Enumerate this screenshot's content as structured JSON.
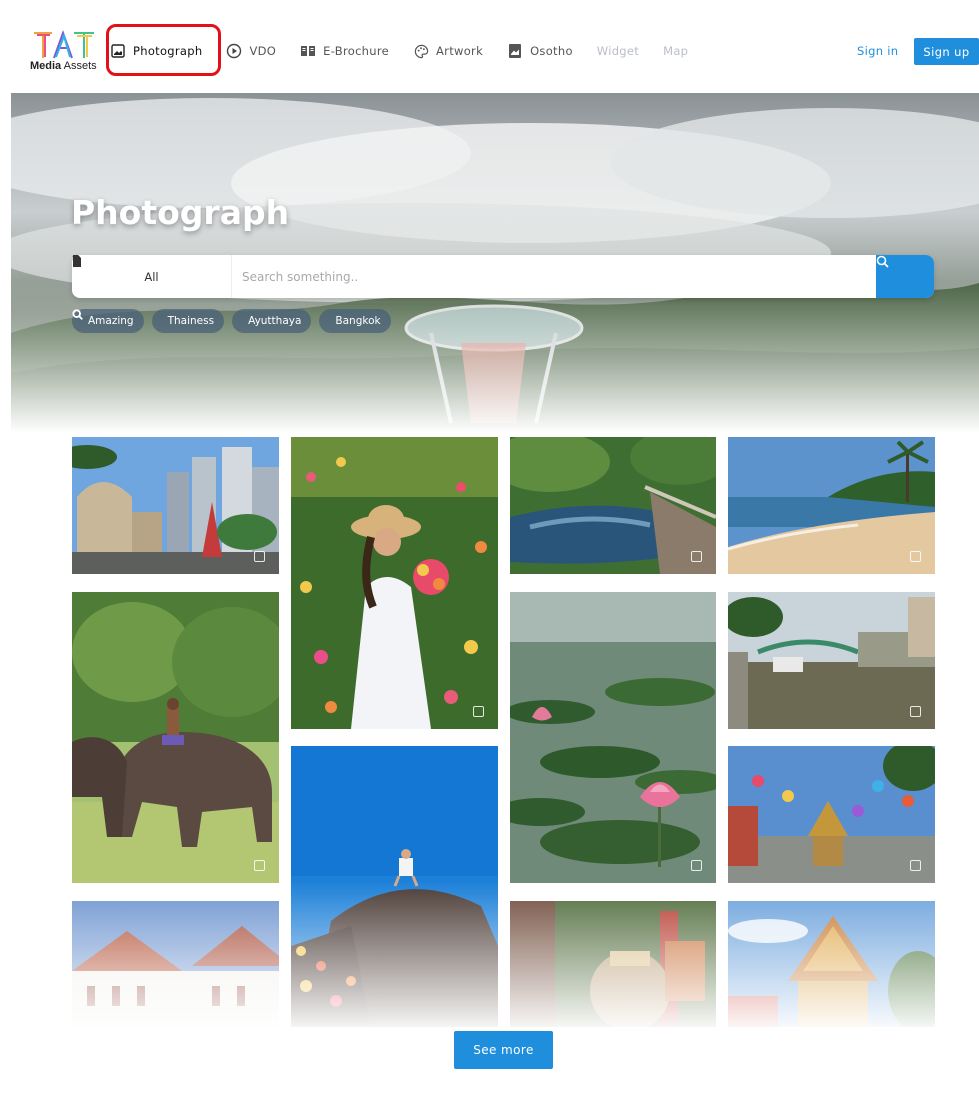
{
  "brand": {
    "logo_mark": "TAT",
    "logo_bold": "Media",
    "logo_rest": " Assets"
  },
  "nav": [
    {
      "label": "Photograph",
      "icon": "image-icon",
      "state": "active"
    },
    {
      "label": "VDO",
      "icon": "play-circle-icon",
      "state": "normal"
    },
    {
      "label": "E-Brochure",
      "icon": "book-open-icon",
      "state": "normal"
    },
    {
      "label": "Artwork",
      "icon": "palette-icon",
      "state": "normal"
    },
    {
      "label": "Osotho",
      "icon": "bookmark-image-icon",
      "state": "normal"
    },
    {
      "label": "Widget",
      "state": "muted"
    },
    {
      "label": "Map",
      "state": "muted"
    }
  ],
  "auth": {
    "signin": "Sign in",
    "signup": "Sign up"
  },
  "hero": {
    "title": "Photograph",
    "select_label": "All",
    "search_placeholder": "Search something..",
    "tags": [
      "Amazing",
      "Thainess",
      "Ayutthaya",
      "Bangkok"
    ]
  },
  "gallery": {
    "photos": [
      "city-building-photo",
      "flower-field-woman-photo",
      "pond-garden-photo",
      "beach-photo",
      "elephants-photo",
      "lotus-pond-photo",
      "canal-bridge-photo",
      "rock-top-traveler-photo",
      "temple-lanterns-photo",
      "white-palace-photo",
      "shrine-statue-photo",
      "golden-temple-photo"
    ],
    "see_more": "See more"
  },
  "colors": {
    "accent": "#1f8fdd",
    "highlight_box": "#e3101a"
  }
}
